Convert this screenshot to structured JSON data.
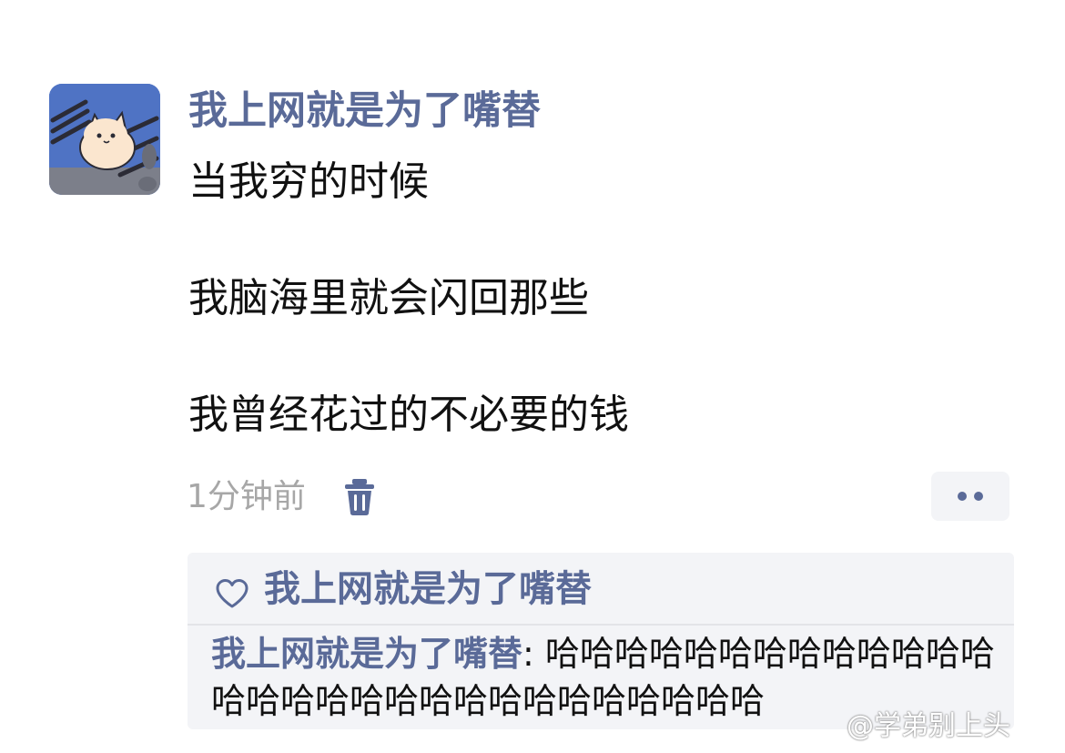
{
  "post": {
    "username": "我上网就是为了嘴替",
    "lines": [
      "当我穷的时候",
      "我脑海里就会闪回那些",
      "我曾经花过的不必要的钱"
    ],
    "timestamp": "1分钟前",
    "icons": {
      "avatar": "cat-avatar-image",
      "delete": "trash-icon",
      "more": "more-dots-icon"
    }
  },
  "interactions": {
    "liker": "我上网就是为了嘴替",
    "like_icon": "heart-icon",
    "comments": [
      {
        "author": "我上网就是为了嘴替",
        "separator": ": ",
        "text": "哈哈哈哈哈哈哈哈哈哈哈哈哈哈哈哈哈哈哈哈哈哈哈哈哈哈哈哈哈"
      }
    ]
  },
  "watermark": "@学弟别上头",
  "colors": {
    "name_blue": "#5a6a98",
    "text": "#111111",
    "muted": "#a7a7a7",
    "panel_bg": "#f3f4f7"
  }
}
